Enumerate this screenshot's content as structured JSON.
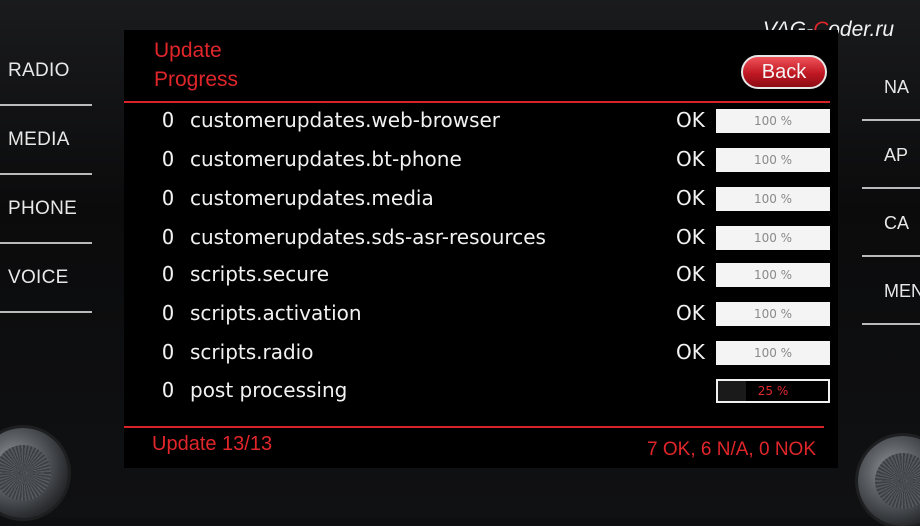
{
  "watermark": {
    "pre": "VAG-",
    "accent": "C",
    "post": "oder.ru"
  },
  "left_buttons": [
    "RADIO",
    "MEDIA",
    "PHONE",
    "VOICE"
  ],
  "right_buttons": [
    "NA",
    "AP",
    "CA",
    "MEN"
  ],
  "screen": {
    "title_line1": "Update",
    "title_line2": "Progress",
    "back_label": "Back",
    "rows": [
      {
        "bullet": "O",
        "name": "customerupdates.web-browser",
        "status": "OK",
        "progress": "100 %",
        "progress_value": 100
      },
      {
        "bullet": "O",
        "name": "customerupdates.bt-phone",
        "status": "OK",
        "progress": "100 %",
        "progress_value": 100
      },
      {
        "bullet": "O",
        "name": "customerupdates.media",
        "status": "OK",
        "progress": "100 %",
        "progress_value": 100
      },
      {
        "bullet": "O",
        "name": "customerupdates.sds-asr-resources",
        "status": "OK",
        "progress": "100 %",
        "progress_value": 100
      },
      {
        "bullet": "O",
        "name": "scripts.secure",
        "status": "OK",
        "progress": "100 %",
        "progress_value": 100
      },
      {
        "bullet": "O",
        "name": "scripts.activation",
        "status": "OK",
        "progress": "100 %",
        "progress_value": 100
      },
      {
        "bullet": "O",
        "name": "scripts.radio",
        "status": "OK",
        "progress": "100 %",
        "progress_value": 100
      },
      {
        "bullet": "O",
        "name": "post processing",
        "status": "",
        "progress": "25 %",
        "progress_value": 25
      }
    ],
    "footer_left": "Update 13/13",
    "footer_right": "7 OK, 6 N/A, 0 NOK"
  },
  "colors": {
    "accent_red": "#e0262a",
    "screen_bg": "#000000",
    "text": "#f2f2f2"
  }
}
